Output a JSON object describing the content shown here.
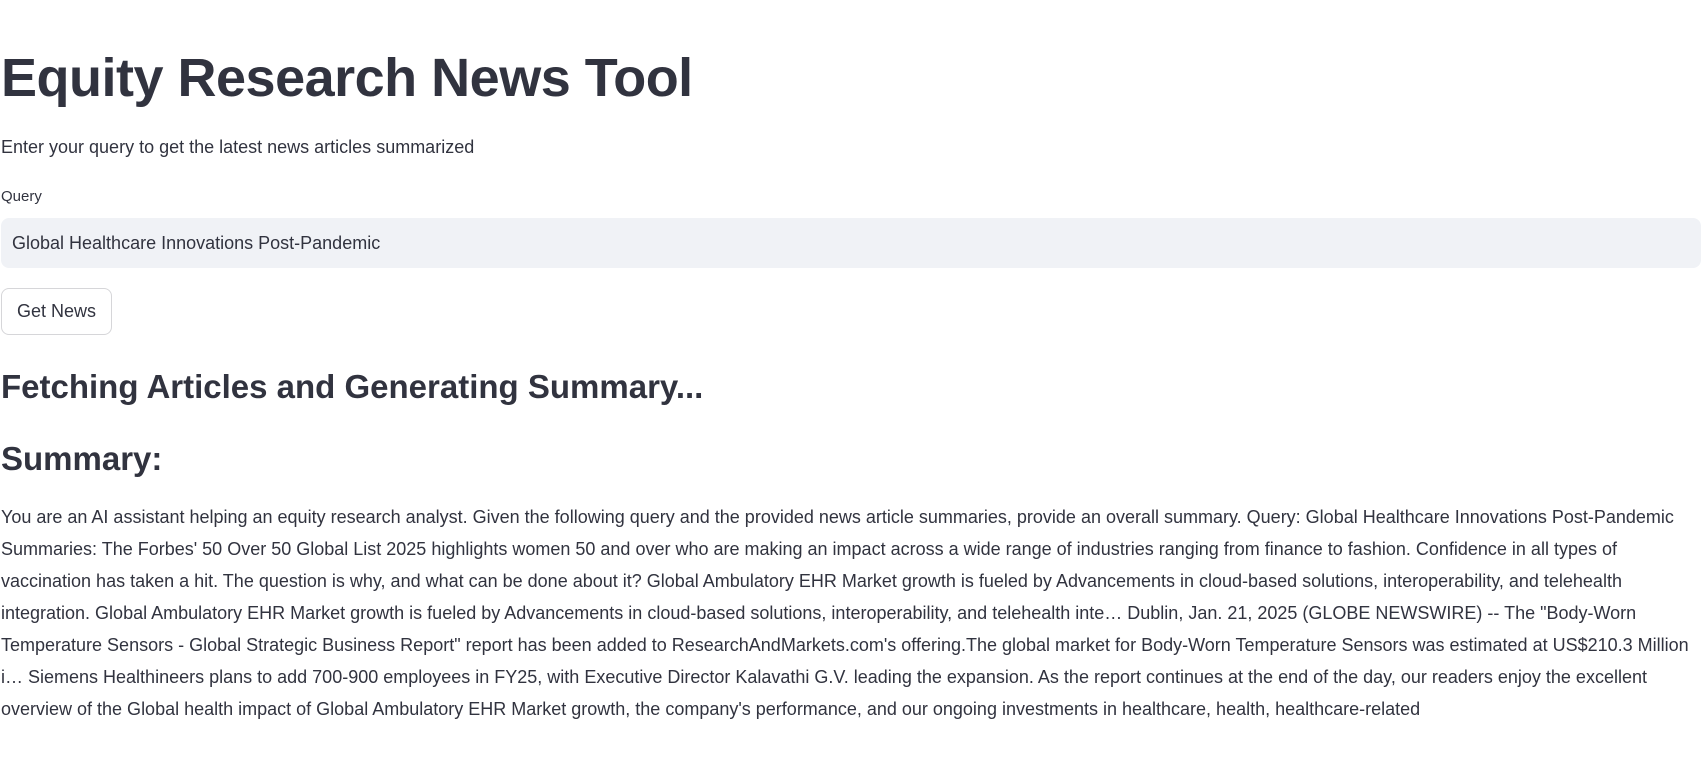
{
  "app": {
    "title": "Equity Research News Tool",
    "subtitle": "Enter your query to get the latest news articles summarized"
  },
  "query": {
    "label": "Query",
    "value": "Global Healthcare Innovations Post-Pandemic"
  },
  "actions": {
    "get_news_label": "Get News"
  },
  "status": {
    "heading": "Fetching Articles and Generating Summary..."
  },
  "summary": {
    "heading": "Summary:",
    "text": "You are an AI assistant helping an equity research analyst. Given the following query and the provided news article summaries, provide an overall summary. Query: Global Healthcare Innovations Post-Pandemic Summaries: The Forbes' 50 Over 50 Global List 2025 highlights women 50 and over who are making an impact across a wide range of industries ranging from finance to fashion. Confidence in all types of vaccination has taken a hit. The question is why, and what can be done about it? Global Ambulatory EHR Market growth is fueled by Advancements in cloud-based solutions, interoperability, and telehealth integration. Global Ambulatory EHR Market growth is fueled by Advancements in cloud-based solutions, interoperability, and telehealth inte… Dublin, Jan. 21, 2025 (GLOBE NEWSWIRE) -- The \"Body-Worn Temperature Sensors - Global Strategic Business Report\" report has been added to ResearchAndMarkets.com's offering.The global market for Body-Worn Temperature Sensors was estimated at US$210.3 Million i… Siemens Healthineers plans to add 700-900 employees in FY25, with Executive Director Kalavathi G.V. leading the expansion. As the report continues at the end of the day, our readers enjoy the excellent overview of the Global health impact of Global Ambulatory EHR Market growth, the company's performance, and our ongoing investments in healthcare, health, healthcare-related"
  },
  "colors": {
    "text": "#31333f",
    "input_background": "#f0f2f6",
    "button_border": "#d6d6d9",
    "page_background": "#ffffff"
  }
}
